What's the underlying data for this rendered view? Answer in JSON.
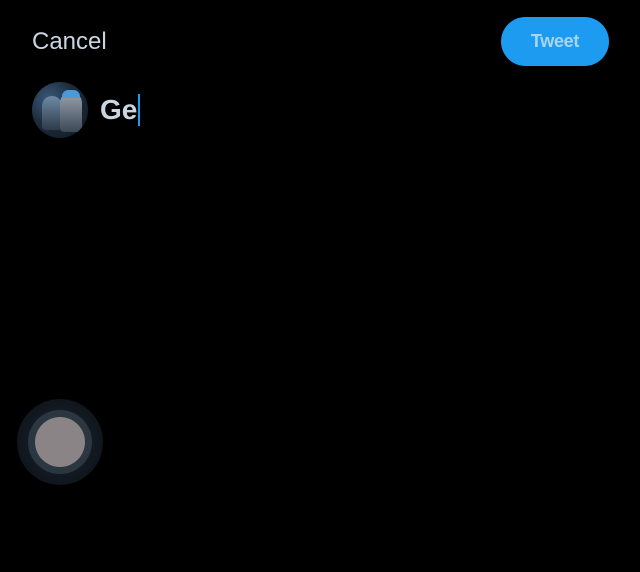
{
  "header": {
    "cancel_label": "Cancel",
    "tweet_label": "Tweet"
  },
  "compose": {
    "text": "Ge"
  },
  "colors": {
    "background": "#000000",
    "accent": "#1d9bf0",
    "text": "#c9d6e2"
  },
  "icons": {
    "avatar": "profile-avatar",
    "touch": "touch-indicator"
  }
}
